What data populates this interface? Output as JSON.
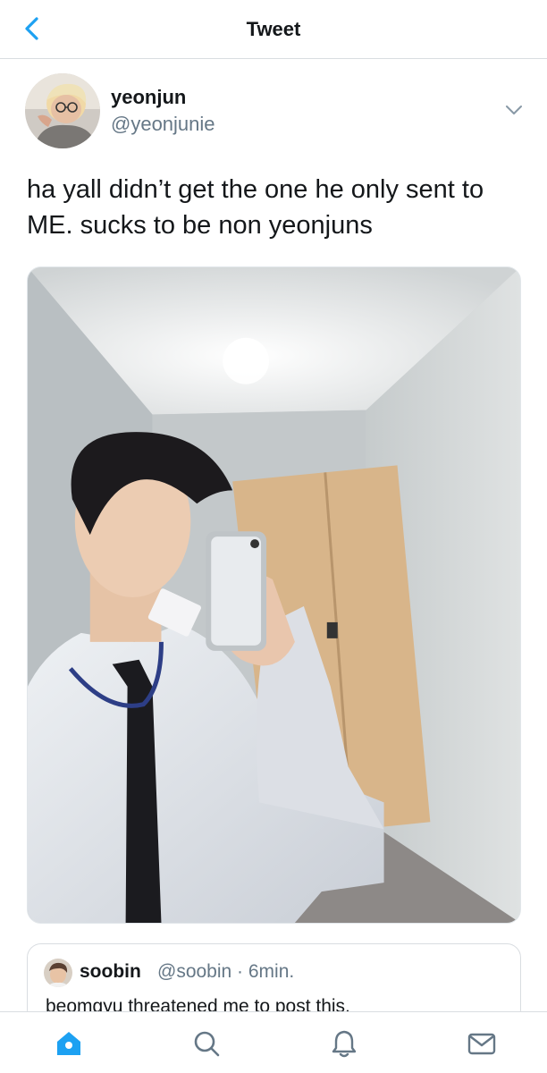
{
  "nav": {
    "title": "Tweet",
    "back_icon": "chevron-left-icon"
  },
  "tweet": {
    "author_name": "yeonjun",
    "author_handle": "@yeonjunie",
    "text": "ha yall didn’t get the one he only sent to ME. sucks to be non yeonjuns",
    "options_icon": "chevron-down-icon"
  },
  "quote": {
    "author_name": "soobin",
    "meta": "@soobin · 6min.",
    "text": "beomgyu threatened me to post this."
  },
  "tabbar": {
    "icons": [
      "home-icon",
      "search-icon",
      "notifications-icon",
      "messages-icon"
    ]
  },
  "colors": {
    "accent": "#1da1f2",
    "secondary_text": "#657786",
    "divider": "#d9dde1"
  }
}
